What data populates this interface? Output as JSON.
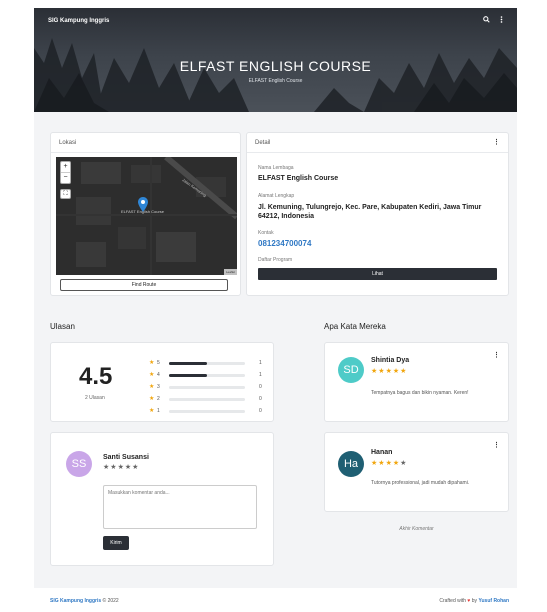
{
  "navbar": {
    "brand": "SIG Kampung Inggris",
    "search_icon": "search-icon",
    "menu_icon": "kebab-menu-icon"
  },
  "hero": {
    "title": "ELFAST ENGLISH COURSE",
    "subtitle": "ELFAST English Course"
  },
  "location_card": {
    "title": "Lokasi",
    "zoom_in": "+",
    "zoom_out": "−",
    "fullscreen": "⛶",
    "marker_label": "ELFAST English Course",
    "road_label": "Jalan Kemuning",
    "attribution": "Leaflet",
    "find_route": "Find Route"
  },
  "detail_card": {
    "title": "Detail",
    "name_label": "Nama Lembaga",
    "name": "ELFAST English Course",
    "address_label": "Alamat Lengkap",
    "address": "Jl. Kemuning, Tulungrejo, Kec. Pare, Kabupaten Kediri, Jawa Timur 64212, Indonesia",
    "contact_label": "Kontak",
    "contact": "081234700074",
    "programs_label": "Daftar Program",
    "programs_button": "Lihat"
  },
  "reviews": {
    "title": "Ulasan",
    "average": "4.5",
    "count_label": "2 Ulasan",
    "breakdown": [
      {
        "stars": "5",
        "count": "1",
        "fraction": 0.5
      },
      {
        "stars": "4",
        "count": "1",
        "fraction": 0.5
      },
      {
        "stars": "3",
        "count": "0",
        "fraction": 0
      },
      {
        "stars": "2",
        "count": "0",
        "fraction": 0
      },
      {
        "stars": "1",
        "count": "0",
        "fraction": 0
      }
    ]
  },
  "comment_form": {
    "user_initials": "SS",
    "user_name": "Santi Susansi",
    "rating": 0,
    "placeholder": "Masukkan komentar anda...",
    "submit": "Kirim",
    "avatar_color": "#c9a6e8"
  },
  "testimonials": {
    "title": "Apa Kata Mereka",
    "items": [
      {
        "initials": "SD",
        "name": "Shintia Dya",
        "rating": 5,
        "text": "Tempatnya bagus dan bikin nyaman. Keren!",
        "avatar_color": "#4ecbc8"
      },
      {
        "initials": "Ha",
        "name": "Hanan",
        "rating": 4,
        "text": "Tutornya professional, jadi mudah dipahami.",
        "avatar_color": "#1f5f73"
      }
    ],
    "end_label": "Akhir Komentar"
  },
  "footer": {
    "brand": "SIG Kampung Inggris",
    "year": "© 2022",
    "crafted": "Crafted with",
    "heart_icon": "heart-icon",
    "by": "by",
    "author": "Yusuf Rohan"
  },
  "colors": {
    "accent": "#2f78c4",
    "star": "#f1a60e",
    "dark": "#2b2f36",
    "heart": "#e53935"
  }
}
